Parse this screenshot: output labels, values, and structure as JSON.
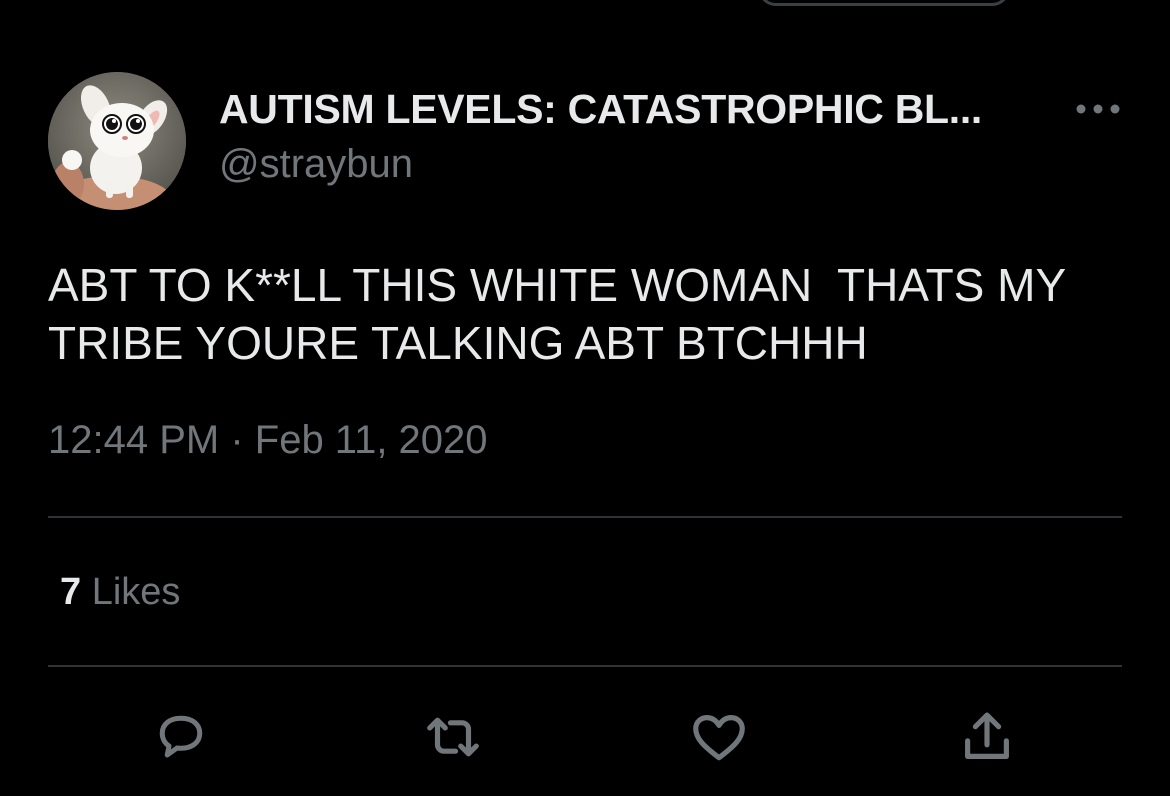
{
  "tweet": {
    "display_name": "AUTISM LEVELS: CATASTROPHIC BL...",
    "handle": "@straybun",
    "text": "ABT TO K**LL THIS WHITE WOMAN  THATS MY TRIBE YOURE TALKING ABT BTCHHH",
    "timestamp": "12:44 PM · Feb 11, 2020",
    "likes_count": "7",
    "likes_label": "Likes"
  },
  "actions": [
    {
      "icon": "reply-icon"
    },
    {
      "icon": "retweet-icon"
    },
    {
      "icon": "like-icon"
    },
    {
      "icon": "share-icon"
    }
  ],
  "colors": {
    "background": "#000000",
    "primary_text": "#e7e9ea",
    "secondary_text": "#71767b",
    "divider": "#2f3336"
  }
}
